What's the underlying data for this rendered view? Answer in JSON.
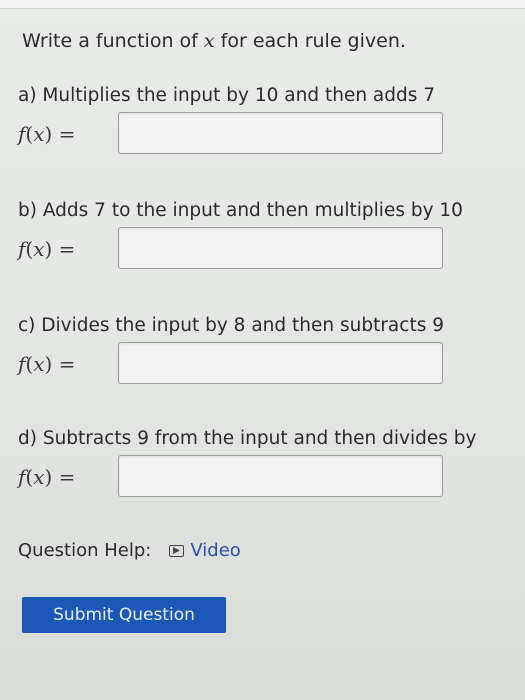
{
  "instructions": {
    "prefix": "Write a function of ",
    "variable": "x",
    "suffix": " for each rule given."
  },
  "parts": [
    {
      "label": "a) Multiplies the input by 10 and then adds 7",
      "value": ""
    },
    {
      "label": "b) Adds 7 to the input and then multiplies by 10",
      "value": ""
    },
    {
      "label": "c) Divides the input by 8 and then subtracts 9",
      "value": ""
    },
    {
      "label": "d) Subtracts 9 from the input and then divides by",
      "value": ""
    }
  ],
  "fx": {
    "f": "f",
    "open": "(",
    "x": "x",
    "close": ") ="
  },
  "help": {
    "label": "Question Help:",
    "video_label": "Video",
    "video_icon": "play-icon"
  },
  "submit_label": "Submit Question",
  "colors": {
    "accent": "#1b58b8",
    "link": "#2b4fa8"
  }
}
